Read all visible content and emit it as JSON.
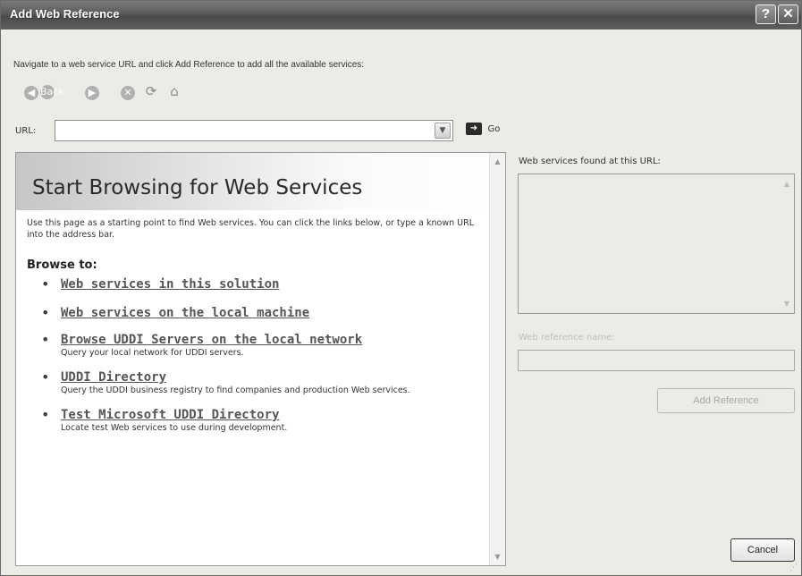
{
  "window": {
    "title": "Add Web Reference",
    "help_glyph": "?",
    "close_glyph": "✕"
  },
  "instructions": "Navigate to a web service URL and click Add Reference to add all the available services:",
  "toolbar": {
    "back_label": "Back",
    "back_icon": "back-arrow-icon",
    "forward_icon": "forward-arrow-icon",
    "stop_icon": "stop-icon",
    "refresh_icon": "refresh-icon",
    "home_icon": "home-icon"
  },
  "url": {
    "label": "URL:",
    "value": "",
    "go_label": "Go"
  },
  "browser": {
    "title": "Start Browsing for Web Services",
    "intro": "Use this page as a starting point to find Web services. You can click the links below, or type a known URL into the address bar.",
    "browse_to": "Browse to:",
    "links": [
      {
        "label": "Web services in this solution",
        "desc": ""
      },
      {
        "label": "Web services on the local machine",
        "desc": ""
      },
      {
        "label": "Browse UDDI Servers on the local network",
        "desc": "Query your local network for UDDI servers."
      },
      {
        "label": "UDDI Directory",
        "desc": "Query the UDDI business registry to find companies and production Web services."
      },
      {
        "label": "Test Microsoft UDDI Directory",
        "desc": "Locate test Web services to use during development."
      }
    ]
  },
  "right_panel": {
    "found_label": "Web services found at this URL:",
    "ref_name_label": "Web reference name:",
    "ref_name_value": "",
    "add_reference_label": "Add Reference",
    "cancel_label": "Cancel"
  },
  "colors": {
    "title_bar": "#5a5a5a",
    "dialog_bg": "#ecebe6",
    "link": "#555555"
  }
}
